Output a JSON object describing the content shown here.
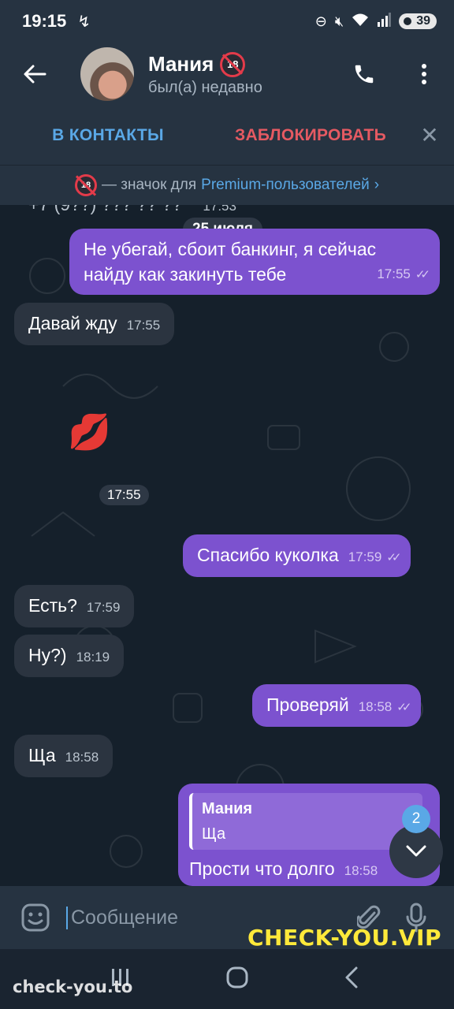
{
  "status_bar": {
    "time": "19:15",
    "battery": "39"
  },
  "header": {
    "contact_name": "Мания",
    "contact_status": "был(а) недавно",
    "badge_text": "18"
  },
  "action_bar": {
    "add_contact": "В КОНТАКТЫ",
    "block": "ЗАБЛОКИРОВАТЬ"
  },
  "premium_bar": {
    "text": "— значок для",
    "link": "Premium-пользователей",
    "chevron": "›"
  },
  "chat": {
    "partial_top_text": "+7 (9??) ??? ?? ??",
    "partial_top_time": "17:53",
    "date_label": "25 июля",
    "messages": [
      {
        "dir": "out",
        "text_line1": "Не убегай,  сбоит  банкинг, я сейчас",
        "text_line2": "найду как закинуть тебе",
        "time": "17:55"
      },
      {
        "dir": "in",
        "text": "Давай жду",
        "time": "17:55"
      },
      {
        "dir": "sticker",
        "emoji": "💋",
        "time": "17:55"
      },
      {
        "dir": "out",
        "text": "Спасибо куколка",
        "time": "17:59"
      },
      {
        "dir": "in",
        "text": "Есть?",
        "time": "17:59"
      },
      {
        "dir": "in",
        "text": "Ну?)",
        "time": "18:19"
      },
      {
        "dir": "out",
        "text": "Проверяй",
        "time": "18:58"
      },
      {
        "dir": "in",
        "text": "Ща",
        "time": "18:58"
      },
      {
        "dir": "out",
        "reply_name": "Мания",
        "reply_text": "Ща",
        "text": "Прости что долго",
        "time": "18:58"
      }
    ],
    "ticks": "✓✓",
    "unread_count": "2"
  },
  "input": {
    "placeholder": "Сообщение"
  },
  "watermarks": {
    "right": "CHECK-YOU.VIP",
    "left": "check-you.to"
  },
  "colors": {
    "accent": "#5aa8e6",
    "danger": "#e55a62",
    "outgoing_bubble": "#7c52cf",
    "incoming_bubble": "#2b3440",
    "header_bg": "#263341",
    "chat_bg": "#15202b"
  }
}
